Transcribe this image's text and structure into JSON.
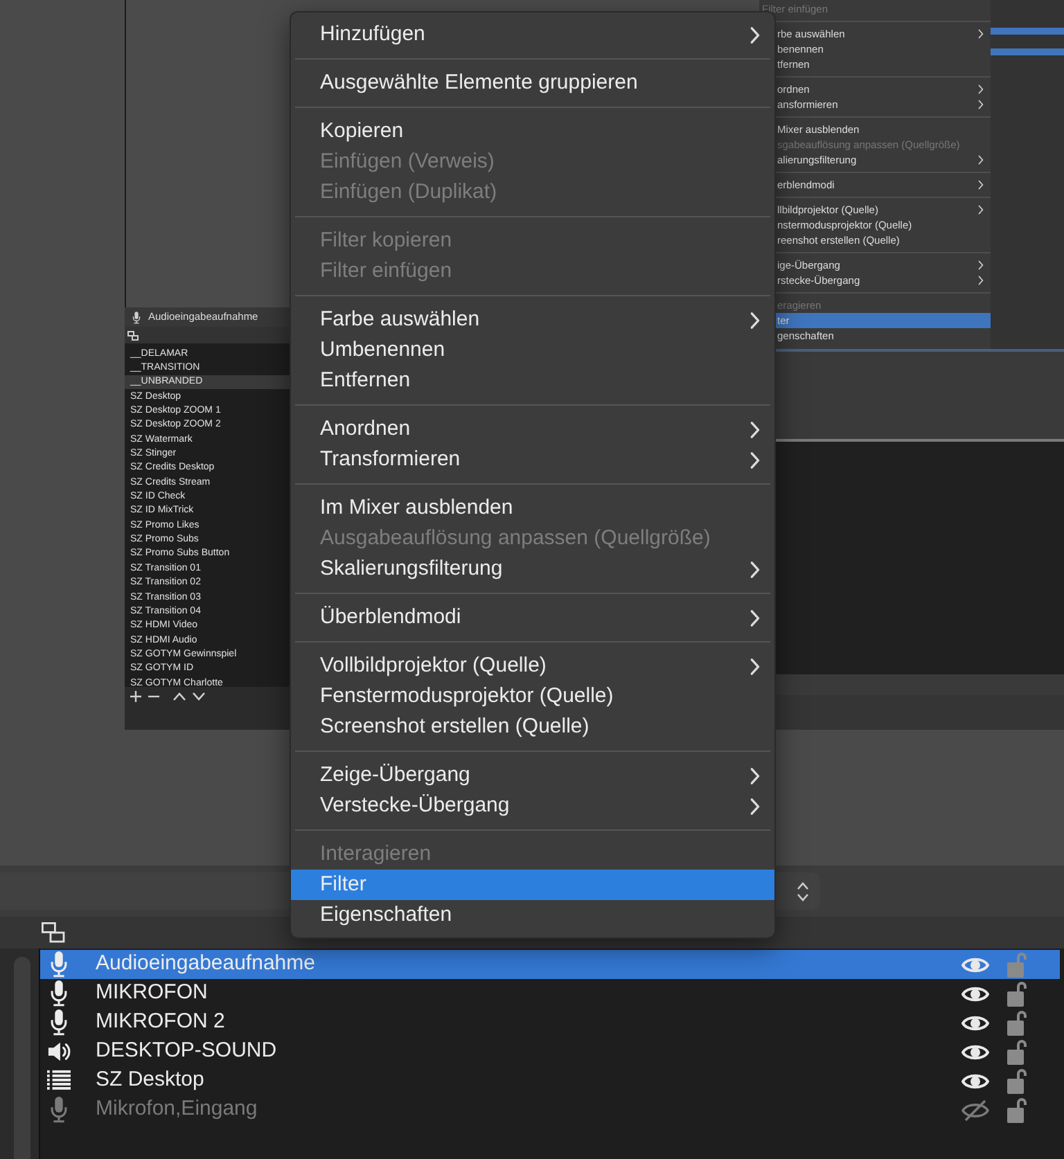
{
  "preview": {
    "scene_panel": {
      "title": "Audioeingabeaufnahme",
      "scenes": [
        {
          "name": "__DELAMAR",
          "selected": false
        },
        {
          "name": "__TRANSITION",
          "selected": false
        },
        {
          "name": "__UNBRANDED",
          "selected": true
        },
        {
          "name": "SZ Desktop",
          "selected": false
        },
        {
          "name": "SZ Desktop ZOOM 1",
          "selected": false
        },
        {
          "name": "SZ Desktop ZOOM 2",
          "selected": false
        },
        {
          "name": "SZ Watermark",
          "selected": false
        },
        {
          "name": "SZ Stinger",
          "selected": false
        },
        {
          "name": "SZ Credits Desktop",
          "selected": false
        },
        {
          "name": "SZ Credits Stream",
          "selected": false
        },
        {
          "name": "SZ ID Check",
          "selected": false
        },
        {
          "name": "SZ ID MixTrick",
          "selected": false
        },
        {
          "name": "SZ Promo Likes",
          "selected": false
        },
        {
          "name": "SZ Promo Subs",
          "selected": false
        },
        {
          "name": "SZ Promo Subs Button",
          "selected": false
        },
        {
          "name": "SZ Transition 01",
          "selected": false
        },
        {
          "name": "SZ Transition 02",
          "selected": false
        },
        {
          "name": "SZ Transition 03",
          "selected": false
        },
        {
          "name": "SZ Transition 04",
          "selected": false
        },
        {
          "name": "SZ HDMI Video",
          "selected": false
        },
        {
          "name": "SZ HDMI Audio",
          "selected": false
        },
        {
          "name": "SZ GOTYM Gewinnspiel",
          "selected": false
        },
        {
          "name": "SZ GOTYM ID",
          "selected": false
        },
        {
          "name": "SZ GOTYM Charlotte",
          "selected": false
        }
      ]
    },
    "menu_snapshot": {
      "sections": [
        {
          "items": [
            {
              "label": "Filter einfügen",
              "disabled": true,
              "selected": false,
              "submenu": false
            }
          ]
        },
        {
          "items": [
            {
              "label": "rbe auswählen",
              "disabled": false,
              "selected": false,
              "submenu": true
            },
            {
              "label": "benennen",
              "disabled": false,
              "selected": false,
              "submenu": false
            },
            {
              "label": "tfernen",
              "disabled": false,
              "selected": false,
              "submenu": false
            }
          ]
        },
        {
          "items": [
            {
              "label": "ordnen",
              "disabled": false,
              "selected": false,
              "submenu": true
            },
            {
              "label": "ansformieren",
              "disabled": false,
              "selected": false,
              "submenu": true
            }
          ]
        },
        {
          "items": [
            {
              "label": "Mixer ausblenden",
              "disabled": false,
              "selected": false,
              "submenu": false
            },
            {
              "label": "sgabeauflösung anpassen (Quellgröße)",
              "disabled": true,
              "selected": false,
              "submenu": false
            },
            {
              "label": "alierungsfilterung",
              "disabled": false,
              "selected": false,
              "submenu": true
            }
          ]
        },
        {
          "items": [
            {
              "label": "erblendmodi",
              "disabled": false,
              "selected": false,
              "submenu": true
            }
          ]
        },
        {
          "items": [
            {
              "label": "llbildprojektor (Quelle)",
              "disabled": false,
              "selected": false,
              "submenu": true
            },
            {
              "label": "nstermodusprojektor (Quelle)",
              "disabled": false,
              "selected": false,
              "submenu": false
            },
            {
              "label": "reenshot erstellen (Quelle)",
              "disabled": false,
              "selected": false,
              "submenu": false
            }
          ]
        },
        {
          "items": [
            {
              "label": "ige-Übergang",
              "disabled": false,
              "selected": false,
              "submenu": true
            },
            {
              "label": "rstecke-Übergang",
              "disabled": false,
              "selected": false,
              "submenu": true
            }
          ]
        },
        {
          "items": [
            {
              "label": "eragieren",
              "disabled": true,
              "selected": false,
              "submenu": false
            },
            {
              "label": "ter",
              "disabled": false,
              "selected": true,
              "submenu": false
            },
            {
              "label": "genschaften",
              "disabled": false,
              "selected": false,
              "submenu": false
            }
          ]
        }
      ]
    }
  },
  "context_menu": {
    "sections": [
      {
        "items": [
          {
            "label": "Hinzufügen",
            "disabled": false,
            "selected": false,
            "submenu": true
          }
        ]
      },
      {
        "items": [
          {
            "label": "Ausgewählte Elemente gruppieren",
            "disabled": false,
            "selected": false,
            "submenu": false
          }
        ]
      },
      {
        "items": [
          {
            "label": "Kopieren",
            "disabled": false,
            "selected": false,
            "submenu": false
          },
          {
            "label": "Einfügen (Verweis)",
            "disabled": true,
            "selected": false,
            "submenu": false
          },
          {
            "label": "Einfügen (Duplikat)",
            "disabled": true,
            "selected": false,
            "submenu": false
          }
        ]
      },
      {
        "items": [
          {
            "label": "Filter kopieren",
            "disabled": true,
            "selected": false,
            "submenu": false
          },
          {
            "label": "Filter einfügen",
            "disabled": true,
            "selected": false,
            "submenu": false
          }
        ]
      },
      {
        "items": [
          {
            "label": "Farbe auswählen",
            "disabled": false,
            "selected": false,
            "submenu": true
          },
          {
            "label": "Umbenennen",
            "disabled": false,
            "selected": false,
            "submenu": false
          },
          {
            "label": "Entfernen",
            "disabled": false,
            "selected": false,
            "submenu": false
          }
        ]
      },
      {
        "items": [
          {
            "label": "Anordnen",
            "disabled": false,
            "selected": false,
            "submenu": true
          },
          {
            "label": "Transformieren",
            "disabled": false,
            "selected": false,
            "submenu": true
          }
        ]
      },
      {
        "items": [
          {
            "label": "Im Mixer ausblenden",
            "disabled": false,
            "selected": false,
            "submenu": false
          },
          {
            "label": "Ausgabeauflösung anpassen (Quellgröße)",
            "disabled": true,
            "selected": false,
            "submenu": false
          },
          {
            "label": "Skalierungsfilterung",
            "disabled": false,
            "selected": false,
            "submenu": true
          }
        ]
      },
      {
        "items": [
          {
            "label": "Überblendmodi",
            "disabled": false,
            "selected": false,
            "submenu": true
          }
        ]
      },
      {
        "items": [
          {
            "label": "Vollbildprojektor (Quelle)",
            "disabled": false,
            "selected": false,
            "submenu": true
          },
          {
            "label": "Fenstermodusprojektor (Quelle)",
            "disabled": false,
            "selected": false,
            "submenu": false
          },
          {
            "label": "Screenshot erstellen (Quelle)",
            "disabled": false,
            "selected": false,
            "submenu": false
          }
        ]
      },
      {
        "items": [
          {
            "label": "Zeige-Übergang",
            "disabled": false,
            "selected": false,
            "submenu": true
          },
          {
            "label": "Verstecke-Übergang",
            "disabled": false,
            "selected": false,
            "submenu": true
          }
        ]
      },
      {
        "items": [
          {
            "label": "Interagieren",
            "disabled": true,
            "selected": false,
            "submenu": false
          },
          {
            "label": "Filter",
            "disabled": false,
            "selected": true,
            "submenu": false
          },
          {
            "label": "Eigenschaften",
            "disabled": false,
            "selected": false,
            "submenu": false
          }
        ]
      }
    ]
  },
  "sources": {
    "items": [
      {
        "name": "Audioeingabeaufnahme",
        "kind": "mic",
        "visible": true,
        "selected": true
      },
      {
        "name": "MIKROFON",
        "kind": "mic",
        "visible": true,
        "selected": false
      },
      {
        "name": "MIKROFON 2",
        "kind": "mic",
        "visible": true,
        "selected": false
      },
      {
        "name": "DESKTOP-SOUND",
        "kind": "speaker",
        "visible": true,
        "selected": false
      },
      {
        "name": "SZ Desktop",
        "kind": "list",
        "visible": true,
        "selected": false
      },
      {
        "name": "Mikrofon,Eingang",
        "kind": "mic",
        "visible": false,
        "selected": false
      }
    ]
  }
}
